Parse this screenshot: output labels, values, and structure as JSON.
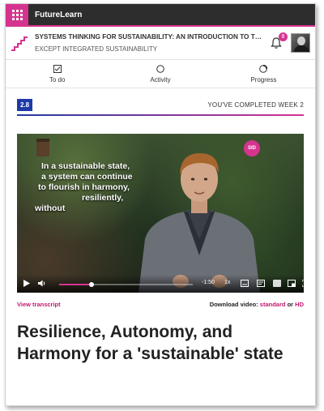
{
  "topbar": {
    "brand": "FutureLearn"
  },
  "course": {
    "title": "SYSTEMS THINKING FOR SUSTAINABILITY: AN INTRODUCTION TO THE SYMBIOSIS",
    "subtitle": "EXCEPT INTEGRATED SUSTAINABILITY",
    "notifications": "8"
  },
  "tabs": [
    {
      "label": "To do",
      "icon": "checkbox-icon"
    },
    {
      "label": "Activity",
      "icon": "circle-icon"
    },
    {
      "label": "Progress",
      "icon": "progress-ring-icon"
    }
  ],
  "week": {
    "step": "2.8",
    "status": "YOU'VE COMPLETED WEEK 2"
  },
  "video": {
    "badge": "SID",
    "captions": [
      "In a sustainable state,",
      "a system can continue",
      "to flourish in harmony,",
      "resiliently,",
      "without"
    ],
    "time": "-1:50",
    "speed": "1x",
    "progress": 0.24
  },
  "links": {
    "transcript": "View transcript",
    "download_label": "Download video:",
    "standard": "standard",
    "or": "or",
    "hd": "HD"
  },
  "step_title": "Resilience, Autonomy, and Harmony for a 'sustainable' state",
  "colors": {
    "brand": "#d6338f",
    "accent_blue": "#1e3aa8",
    "topbar": "#2d2d2d"
  }
}
